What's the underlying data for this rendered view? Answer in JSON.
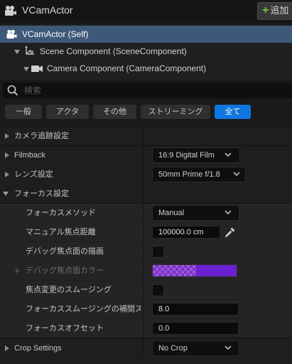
{
  "header": {
    "title": "VCamActor",
    "add_button_label": "追加"
  },
  "tree": {
    "items": [
      {
        "label": "VCamActor (Self)"
      },
      {
        "label": "Scene Component (SceneComponent)"
      },
      {
        "label": "Camera Component (CameraComponent)"
      }
    ]
  },
  "search": {
    "placeholder": "検索"
  },
  "filters": {
    "tabs": [
      {
        "label": "一般"
      },
      {
        "label": "アクタ"
      },
      {
        "label": "その他"
      },
      {
        "label": "ストリーミング"
      },
      {
        "label": "全て"
      }
    ],
    "active": "全て"
  },
  "properties": {
    "camera_tracking": {
      "label": "カメラ追跡設定"
    },
    "filmback": {
      "label": "Filmback",
      "value": "16:9 Digital Film"
    },
    "lens": {
      "label": "レンズ設定",
      "value": "50mm Prime f/1.8"
    },
    "focus": {
      "label": "フォーカス設定",
      "method": {
        "label": "フォーカスメソッド",
        "value": "Manual"
      },
      "manual_distance": {
        "label": "マニュアル焦点距離",
        "value": "100000.0 cm"
      },
      "debug_plane": {
        "label": "デバッグ焦点面の描画",
        "checked": false
      },
      "debug_color": {
        "label": "デバッグ焦点面カラー",
        "color": "#6a22d0"
      },
      "smoothing": {
        "label": "焦点変更のスムージング",
        "checked": false
      },
      "interp_speed": {
        "label": "フォーカススムージングの補間ス...",
        "value": "8.0"
      },
      "offset": {
        "label": "フォーカスオフセット",
        "value": "0.0"
      }
    },
    "crop": {
      "label": "Crop Settings",
      "value": "No Crop"
    }
  },
  "colors": {
    "selection": "#3e5877",
    "active_tab": "#0f75e0",
    "add_plus": "#6ccb3a"
  }
}
